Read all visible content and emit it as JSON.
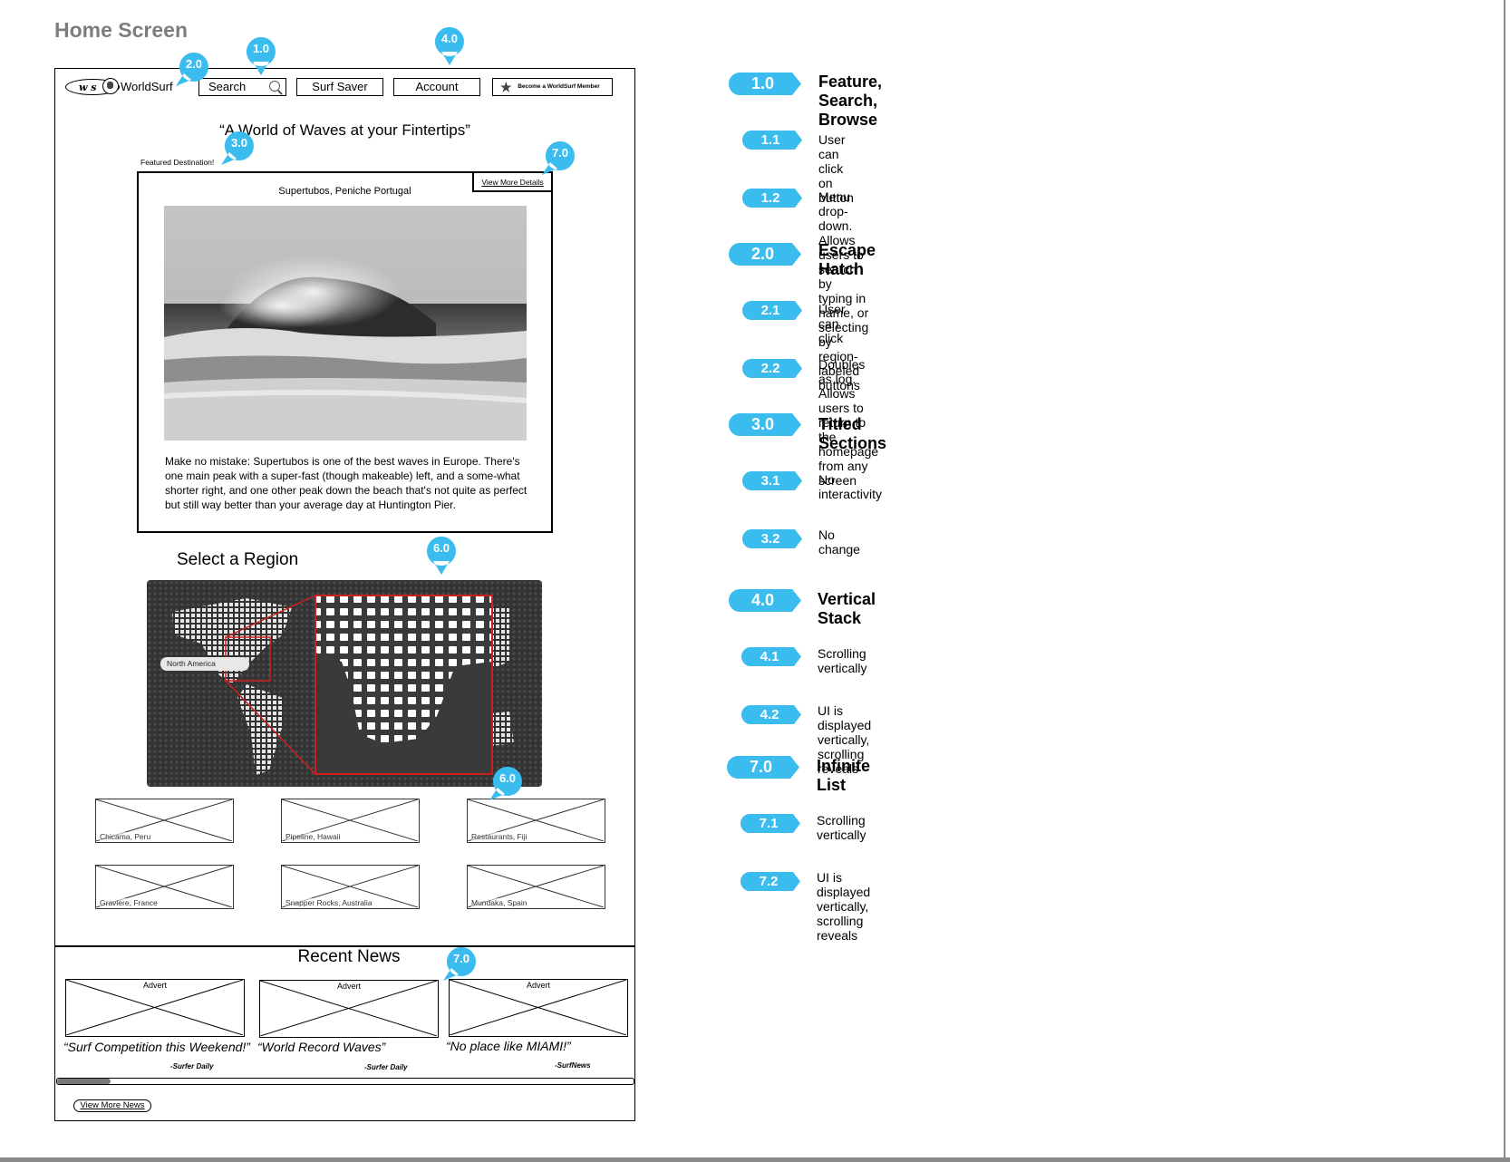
{
  "page_title": "Home Screen",
  "wireframe": {
    "logo": {
      "initials": "w s",
      "name": "WorldSurf"
    },
    "nav": {
      "search_label": "Search",
      "surf_saver_label": "Surf Saver",
      "account_label": "Account",
      "member_label": "Become a WorldSurf Member"
    },
    "tagline": "“A World of Waves at your Fintertips”",
    "featured": {
      "label": "Featured Destination!",
      "view_more_label": "View More Details",
      "destination": "Supertubos, Peniche Portugal",
      "description": "Make no mistake: Supertubos is one of the best waves in Europe. There's one main peak with a super-fast (though makeable) left, and a some-what shorter right, and one other peak down the beach that's not quite as perfect but still way better than your average day at Huntington Pier."
    },
    "region": {
      "title": "Select a Region",
      "map_label": "North America"
    },
    "destinations": [
      "Chicama, Peru",
      "Pipeline, Hawaii",
      "Restaurants, Fiji",
      "Graviere, France",
      "Snapper Rocks, Australia",
      "Mundaka, Spain"
    ],
    "news": {
      "title": "Recent News",
      "items": [
        {
          "advert": "Advert",
          "quote": "“Surf Competition this Weekend!”",
          "source": "-Surfer Daily"
        },
        {
          "advert": "Advert",
          "quote": "“World Record Waves”",
          "source": "-Surfer Daily"
        },
        {
          "advert": "Advert",
          "quote": "“No place like MIAMI!”",
          "source": "-SurfNews"
        }
      ],
      "view_more_label": "View More News"
    },
    "markers": {
      "m1": "1.0",
      "m2": "2.0",
      "m3": "3.0",
      "m4": "4.0",
      "m6a": "6.0",
      "m6b": "6.0",
      "m7a": "7.0",
      "m7b": "7.0"
    }
  },
  "legend": [
    {
      "num": "1.0",
      "text": "Feature, Search, Browse"
    },
    {
      "num": "1.1",
      "text": "User can click on button"
    },
    {
      "num": "1.2",
      "text": "Menu drop-down. Allows users to search by typing in name, or selecting by region-labeled buttons"
    },
    {
      "num": "2.0",
      "text": "Escape Hatch"
    },
    {
      "num": "2.1",
      "text": "User can click"
    },
    {
      "num": "2.2",
      "text": "Doubles as log. Allows users to return to the homepage from any screen"
    },
    {
      "num": "3.0",
      "text": "Titled Sections"
    },
    {
      "num": "3.1",
      "text": "No interactivity"
    },
    {
      "num": "3.2",
      "text": "No change"
    },
    {
      "num": "4.0",
      "text": "Vertical Stack"
    },
    {
      "num": "4.1",
      "text": "Scrolling vertically"
    },
    {
      "num": "4.2",
      "text": "UI is displayed vertically, scrolling reveals"
    },
    {
      "num": "7.0",
      "text": "Infinite List"
    },
    {
      "num": "7.1",
      "text": "Scrolling vertically"
    },
    {
      "num": "7.2",
      "text": "UI is displayed vertically, scrolling reveals"
    }
  ],
  "colors": {
    "marker": "#3bbcef",
    "title_gray": "#7d7d7d",
    "map_red": "#cc1f1f"
  }
}
